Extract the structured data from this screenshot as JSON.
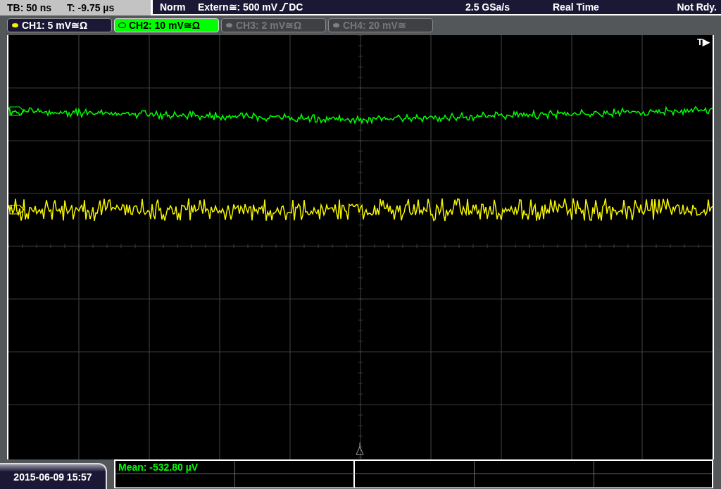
{
  "header": {
    "timebase": "TB: 50 ns",
    "trigger_time": "T: -9.75 µs",
    "trigger_mode": "Norm",
    "trigger_source": "Extern≅: 500 mV",
    "coupling": "DC",
    "sample_rate": "2.5 GSa/s",
    "acquisition": "Real Time",
    "status": "Not Rdy."
  },
  "channels": [
    {
      "label": "CH1: 5 mV≅Ω",
      "color": "#f5f500",
      "on": true,
      "selected": false
    },
    {
      "label": "CH2: 10 mV≅Ω",
      "color": "#00ff00",
      "on": true,
      "selected": true
    },
    {
      "label": "CH3: 2 mV≅Ω",
      "color": "#808080",
      "on": false,
      "selected": false
    },
    {
      "label": "CH4: 20 mV≅",
      "color": "#808080",
      "on": false,
      "selected": false
    }
  ],
  "plot": {
    "trigger_marker": "T▶"
  },
  "footer": {
    "datetime": "2015-06-09 15:57",
    "measurements": [
      "Mean: -532.80 µV"
    ]
  }
}
